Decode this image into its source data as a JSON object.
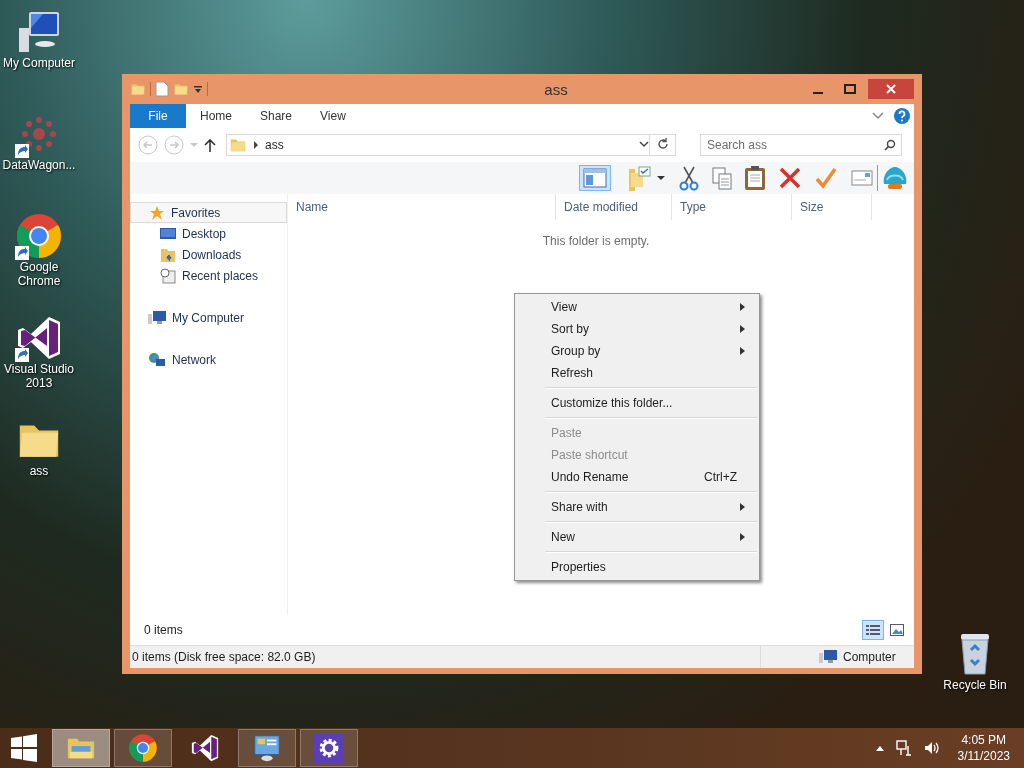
{
  "desktop_icons": [
    {
      "label": "My Computer",
      "kind": "computer",
      "shortcut": false
    },
    {
      "label": "DataWagon...",
      "kind": "datawagon",
      "shortcut": true
    },
    {
      "label": "Google Chrome",
      "kind": "chrome",
      "shortcut": true
    },
    {
      "label": "Visual Studio 2013",
      "kind": "vs",
      "shortcut": true
    },
    {
      "label": "ass",
      "kind": "folder",
      "shortcut": false
    }
  ],
  "recycle_bin": {
    "label": "Recycle Bin"
  },
  "window": {
    "title": "ass",
    "ribbon_tabs": [
      {
        "label": "File",
        "kind": "file"
      },
      {
        "label": "Home",
        "kind": "tab"
      },
      {
        "label": "Share",
        "kind": "tab"
      },
      {
        "label": "View",
        "kind": "tab"
      }
    ],
    "address": {
      "path": "ass"
    },
    "search": {
      "placeholder": "Search ass"
    },
    "navigation": [
      {
        "label": "Favorites",
        "kind": "favorites",
        "selected": true,
        "children": [
          {
            "label": "Desktop",
            "kind": "desktop",
            "selected": false
          },
          {
            "label": "Downloads",
            "kind": "downloads",
            "selected": false
          },
          {
            "label": "Recent places",
            "kind": "recent",
            "selected": false
          }
        ]
      },
      {
        "label": "My Computer",
        "kind": "computer",
        "selected": false
      },
      {
        "label": "Network",
        "kind": "network",
        "selected": false
      }
    ],
    "columns": [
      "Name",
      "Date modified",
      "Type",
      "Size"
    ],
    "empty_message": "This folder is empty.",
    "item_count": "0 items",
    "view_buttons": [
      {
        "kind": "details",
        "selected": true
      },
      {
        "kind": "large-icons",
        "selected": false
      }
    ],
    "status_bar": {
      "text": "0 items (Disk free space: 82.0 GB)",
      "location": "Computer"
    }
  },
  "context_menu": [
    [
      {
        "label": "View",
        "submenu": true,
        "disabled": false
      },
      {
        "label": "Sort by",
        "submenu": true,
        "disabled": false
      },
      {
        "label": "Group by",
        "submenu": true,
        "disabled": false
      },
      {
        "label": "Refresh",
        "submenu": false,
        "disabled": false
      }
    ],
    [
      {
        "label": "Customize this folder...",
        "submenu": false,
        "disabled": false
      }
    ],
    [
      {
        "label": "Paste",
        "submenu": false,
        "disabled": true
      },
      {
        "label": "Paste shortcut",
        "submenu": false,
        "disabled": true
      },
      {
        "label": "Undo Rename",
        "shortcut": "Ctrl+Z",
        "submenu": false,
        "disabled": false
      }
    ],
    [
      {
        "label": "Share with",
        "submenu": true,
        "disabled": false
      }
    ],
    [
      {
        "label": "New",
        "submenu": true,
        "disabled": false
      }
    ],
    [
      {
        "label": "Properties",
        "submenu": false,
        "disabled": false
      }
    ]
  ],
  "taskbar": {
    "apps": [
      {
        "kind": "explorer",
        "selected": true,
        "running": true
      },
      {
        "kind": "chrome",
        "selected": false,
        "running": true
      },
      {
        "kind": "vs",
        "selected": false,
        "running": false
      },
      {
        "kind": "control-panel",
        "selected": false,
        "running": true
      },
      {
        "kind": "settings",
        "selected": false,
        "running": true
      }
    ],
    "time": "4:05 PM",
    "date": "3/11/2023"
  }
}
